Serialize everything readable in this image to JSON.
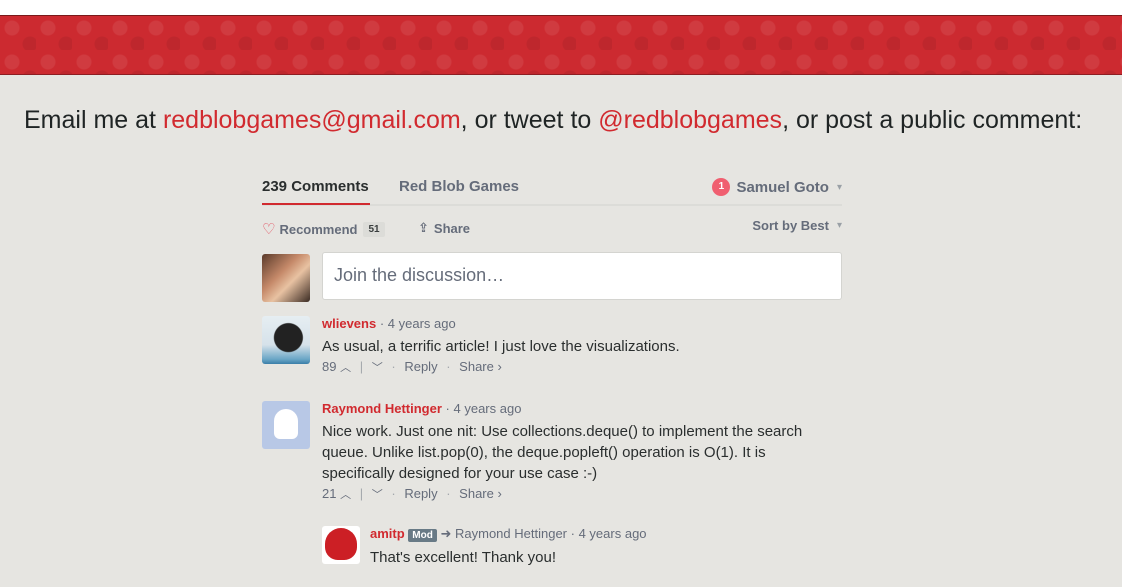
{
  "contact": {
    "prefix": "Email me at ",
    "email": "redblobgames@gmail.com",
    "middle": ", or tweet to ",
    "twitter": "@redblobgames",
    "suffix": ", or post a public comment:"
  },
  "disqus": {
    "tabs": [
      {
        "label": "239 Comments"
      },
      {
        "label": "Red Blob Games"
      }
    ],
    "user": {
      "name": "Samuel Goto",
      "notifications": "1"
    },
    "recommend": {
      "label": "Recommend",
      "count": "51"
    },
    "share_label": "Share",
    "sort_label": "Sort by Best",
    "compose_placeholder": "Join the discussion…",
    "comments": [
      {
        "author": "wlievens",
        "time": "4 years ago",
        "text": "As usual, a terrific article! I just love the visualizations.",
        "votes": "89",
        "reply": "Reply",
        "share": "Share ›"
      },
      {
        "author": "Raymond Hettinger",
        "time": "4 years ago",
        "text": "Nice work. Just one nit: Use collections.deque() to implement the search queue. Unlike list.pop(0), the deque.popleft() operation is O(1). It is specifically designed for your use case :-)",
        "votes": "21",
        "reply": "Reply",
        "share": "Share ›"
      },
      {
        "author": "amitp",
        "badge": "Mod",
        "reply_to": "Raymond Hettinger",
        "time": "4 years ago",
        "text": "That's excellent! Thank you!"
      }
    ]
  },
  "colors": {
    "accent": "#d12a2f",
    "banner": "#cc2a30",
    "background": "#e6e5e1"
  }
}
